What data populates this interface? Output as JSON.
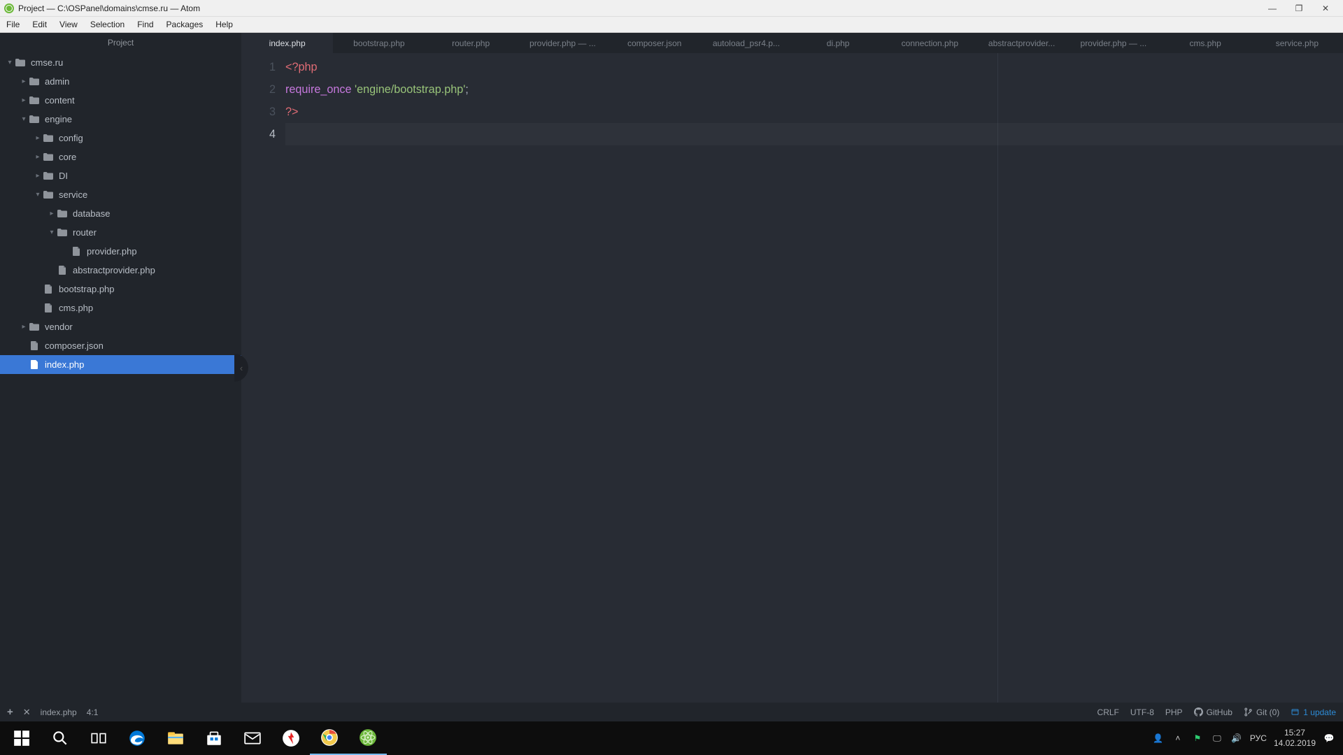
{
  "window": {
    "title": "Project — C:\\OSPanel\\domains\\cmse.ru — Atom"
  },
  "menus": [
    "File",
    "Edit",
    "View",
    "Selection",
    "Find",
    "Packages",
    "Help"
  ],
  "projectPanel": {
    "header": "Project"
  },
  "tree": [
    {
      "label": "cmse.ru",
      "type": "folder",
      "depth": 0,
      "chevron": "down"
    },
    {
      "label": "admin",
      "type": "folder",
      "depth": 1,
      "chevron": "right"
    },
    {
      "label": "content",
      "type": "folder",
      "depth": 1,
      "chevron": "right"
    },
    {
      "label": "engine",
      "type": "folder",
      "depth": 1,
      "chevron": "down"
    },
    {
      "label": "config",
      "type": "folder",
      "depth": 2,
      "chevron": "right"
    },
    {
      "label": "core",
      "type": "folder",
      "depth": 2,
      "chevron": "right"
    },
    {
      "label": "DI",
      "type": "folder",
      "depth": 2,
      "chevron": "right"
    },
    {
      "label": "service",
      "type": "folder",
      "depth": 2,
      "chevron": "down"
    },
    {
      "label": "database",
      "type": "folder",
      "depth": 3,
      "chevron": "right"
    },
    {
      "label": "router",
      "type": "folder",
      "depth": 3,
      "chevron": "down"
    },
    {
      "label": "provider.php",
      "type": "file",
      "depth": 4,
      "chevron": "none"
    },
    {
      "label": "abstractprovider.php",
      "type": "file",
      "depth": 3,
      "chevron": "none"
    },
    {
      "label": "bootstrap.php",
      "type": "file",
      "depth": 2,
      "chevron": "none"
    },
    {
      "label": "cms.php",
      "type": "file",
      "depth": 2,
      "chevron": "none"
    },
    {
      "label": "vendor",
      "type": "folder",
      "depth": 1,
      "chevron": "right"
    },
    {
      "label": "composer.json",
      "type": "file",
      "depth": 1,
      "chevron": "none"
    },
    {
      "label": "index.php",
      "type": "file",
      "depth": 1,
      "chevron": "none",
      "selected": true
    }
  ],
  "tabs": [
    {
      "label": "index.php",
      "active": true
    },
    {
      "label": "bootstrap.php"
    },
    {
      "label": "router.php"
    },
    {
      "label": "provider.php — ..."
    },
    {
      "label": "composer.json"
    },
    {
      "label": "autoload_psr4.p..."
    },
    {
      "label": "di.php"
    },
    {
      "label": "connection.php"
    },
    {
      "label": "abstractprovider..."
    },
    {
      "label": "provider.php — ..."
    },
    {
      "label": "cms.php"
    },
    {
      "label": "service.php"
    }
  ],
  "lines": [
    "1",
    "2",
    "3",
    "4"
  ],
  "code": {
    "l1": "<?php",
    "l2_key": "require_once",
    "l2_str": "'engine/bootstrap.php'",
    "l2_punc": ";",
    "l3": "?>"
  },
  "status": {
    "file": "index.php",
    "cursor": "4:1",
    "eol": "CRLF",
    "enc": "UTF-8",
    "lang": "PHP",
    "github": "GitHub",
    "git": "Git (0)",
    "update": "1 update"
  },
  "tray": {
    "lang": "РУС",
    "time": "15:27",
    "date": "14.02.2019"
  }
}
